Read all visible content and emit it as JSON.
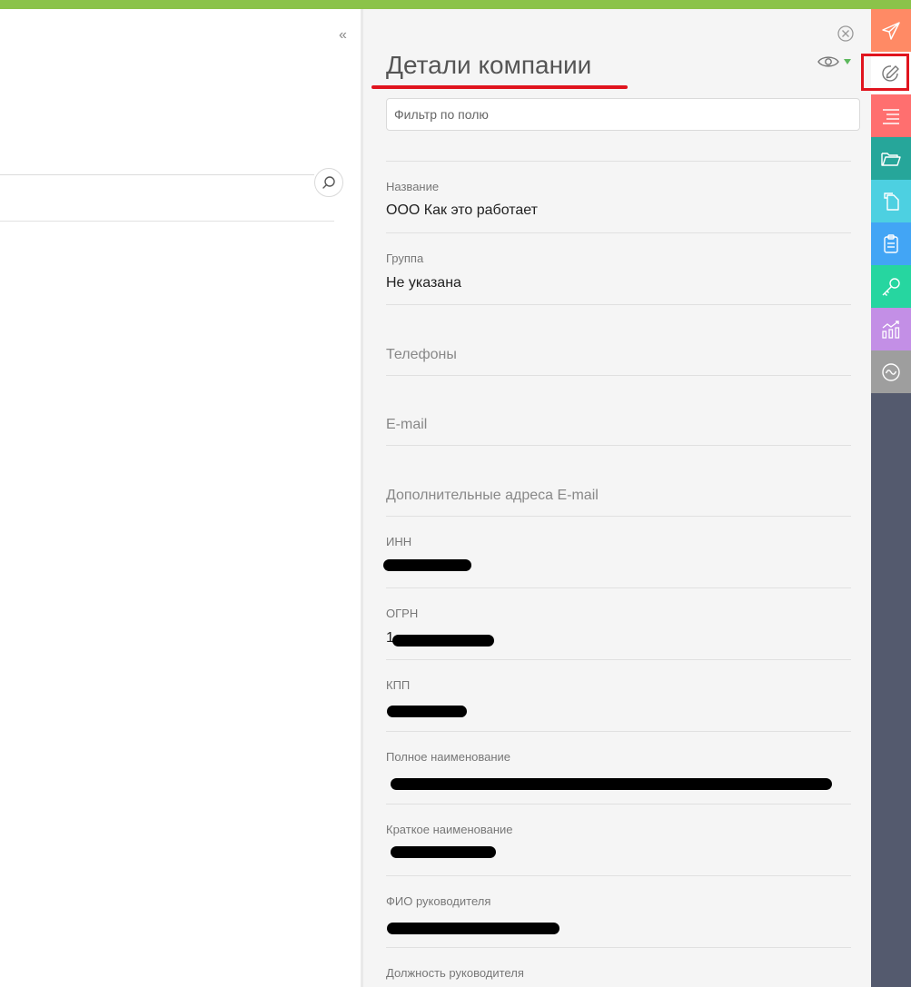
{
  "details": {
    "title": "Детали компании",
    "filter_placeholder": "Фильтр по полю",
    "fields": [
      {
        "label": "Название",
        "value": "ООО Как это работает"
      },
      {
        "label": "Группа",
        "value": "Не указана"
      },
      {
        "label": "Телефоны"
      },
      {
        "label": "E-mail"
      },
      {
        "label": "Дополнительные адреса E-mail"
      },
      {
        "label": "ИНН"
      },
      {
        "label": "ОГРН",
        "value_prefix": "1"
      },
      {
        "label": "КПП"
      },
      {
        "label": "Полное наименование"
      },
      {
        "label": "Краткое наименование"
      },
      {
        "label": "ФИО руководителя"
      },
      {
        "label": "Должность руководителя"
      }
    ]
  },
  "rail": {
    "items": [
      {
        "icon": "paper-plane-icon",
        "color": "#ff8a65"
      },
      {
        "icon": "pencil-icon",
        "color": "#ffffff"
      },
      {
        "icon": "list-lines-icon",
        "color": "#ff6f6f"
      },
      {
        "icon": "folder-icon",
        "color": "#26a69a"
      },
      {
        "icon": "documents-icon",
        "color": "#4dd0e1"
      },
      {
        "icon": "clipboard-icon",
        "color": "#42a5f5"
      },
      {
        "icon": "key-icon",
        "color": "#26d6a0"
      },
      {
        "icon": "chart-icon",
        "color": "#c38fe6"
      },
      {
        "icon": "wave-circle-icon",
        "color": "#9e9e9e"
      }
    ]
  },
  "colors": {
    "topbar": "#8bc34a",
    "highlight": "#e0141e",
    "rail_background": "#545a6e",
    "panel_background": "#f5f5f5"
  }
}
